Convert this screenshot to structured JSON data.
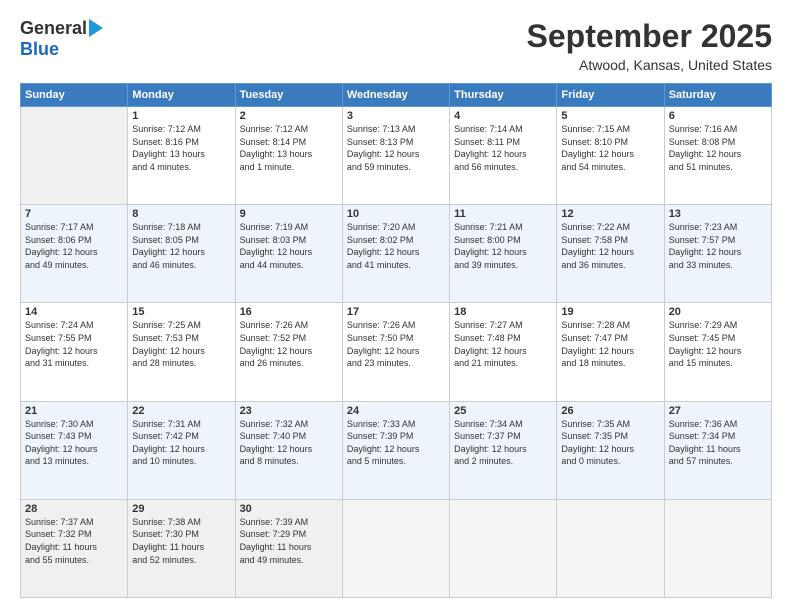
{
  "logo": {
    "general": "General",
    "blue": "Blue"
  },
  "title": "September 2025",
  "location": "Atwood, Kansas, United States",
  "days_of_week": [
    "Sunday",
    "Monday",
    "Tuesday",
    "Wednesday",
    "Thursday",
    "Friday",
    "Saturday"
  ],
  "weeks": [
    [
      {
        "day": "",
        "info": ""
      },
      {
        "day": "1",
        "info": "Sunrise: 7:12 AM\nSunset: 8:16 PM\nDaylight: 13 hours\nand 4 minutes."
      },
      {
        "day": "2",
        "info": "Sunrise: 7:12 AM\nSunset: 8:14 PM\nDaylight: 13 hours\nand 1 minute."
      },
      {
        "day": "3",
        "info": "Sunrise: 7:13 AM\nSunset: 8:13 PM\nDaylight: 12 hours\nand 59 minutes."
      },
      {
        "day": "4",
        "info": "Sunrise: 7:14 AM\nSunset: 8:11 PM\nDaylight: 12 hours\nand 56 minutes."
      },
      {
        "day": "5",
        "info": "Sunrise: 7:15 AM\nSunset: 8:10 PM\nDaylight: 12 hours\nand 54 minutes."
      },
      {
        "day": "6",
        "info": "Sunrise: 7:16 AM\nSunset: 8:08 PM\nDaylight: 12 hours\nand 51 minutes."
      }
    ],
    [
      {
        "day": "7",
        "info": "Sunrise: 7:17 AM\nSunset: 8:06 PM\nDaylight: 12 hours\nand 49 minutes."
      },
      {
        "day": "8",
        "info": "Sunrise: 7:18 AM\nSunset: 8:05 PM\nDaylight: 12 hours\nand 46 minutes."
      },
      {
        "day": "9",
        "info": "Sunrise: 7:19 AM\nSunset: 8:03 PM\nDaylight: 12 hours\nand 44 minutes."
      },
      {
        "day": "10",
        "info": "Sunrise: 7:20 AM\nSunset: 8:02 PM\nDaylight: 12 hours\nand 41 minutes."
      },
      {
        "day": "11",
        "info": "Sunrise: 7:21 AM\nSunset: 8:00 PM\nDaylight: 12 hours\nand 39 minutes."
      },
      {
        "day": "12",
        "info": "Sunrise: 7:22 AM\nSunset: 7:58 PM\nDaylight: 12 hours\nand 36 minutes."
      },
      {
        "day": "13",
        "info": "Sunrise: 7:23 AM\nSunset: 7:57 PM\nDaylight: 12 hours\nand 33 minutes."
      }
    ],
    [
      {
        "day": "14",
        "info": "Sunrise: 7:24 AM\nSunset: 7:55 PM\nDaylight: 12 hours\nand 31 minutes."
      },
      {
        "day": "15",
        "info": "Sunrise: 7:25 AM\nSunset: 7:53 PM\nDaylight: 12 hours\nand 28 minutes."
      },
      {
        "day": "16",
        "info": "Sunrise: 7:26 AM\nSunset: 7:52 PM\nDaylight: 12 hours\nand 26 minutes."
      },
      {
        "day": "17",
        "info": "Sunrise: 7:26 AM\nSunset: 7:50 PM\nDaylight: 12 hours\nand 23 minutes."
      },
      {
        "day": "18",
        "info": "Sunrise: 7:27 AM\nSunset: 7:48 PM\nDaylight: 12 hours\nand 21 minutes."
      },
      {
        "day": "19",
        "info": "Sunrise: 7:28 AM\nSunset: 7:47 PM\nDaylight: 12 hours\nand 18 minutes."
      },
      {
        "day": "20",
        "info": "Sunrise: 7:29 AM\nSunset: 7:45 PM\nDaylight: 12 hours\nand 15 minutes."
      }
    ],
    [
      {
        "day": "21",
        "info": "Sunrise: 7:30 AM\nSunset: 7:43 PM\nDaylight: 12 hours\nand 13 minutes."
      },
      {
        "day": "22",
        "info": "Sunrise: 7:31 AM\nSunset: 7:42 PM\nDaylight: 12 hours\nand 10 minutes."
      },
      {
        "day": "23",
        "info": "Sunrise: 7:32 AM\nSunset: 7:40 PM\nDaylight: 12 hours\nand 8 minutes."
      },
      {
        "day": "24",
        "info": "Sunrise: 7:33 AM\nSunset: 7:39 PM\nDaylight: 12 hours\nand 5 minutes."
      },
      {
        "day": "25",
        "info": "Sunrise: 7:34 AM\nSunset: 7:37 PM\nDaylight: 12 hours\nand 2 minutes."
      },
      {
        "day": "26",
        "info": "Sunrise: 7:35 AM\nSunset: 7:35 PM\nDaylight: 12 hours\nand 0 minutes."
      },
      {
        "day": "27",
        "info": "Sunrise: 7:36 AM\nSunset: 7:34 PM\nDaylight: 11 hours\nand 57 minutes."
      }
    ],
    [
      {
        "day": "28",
        "info": "Sunrise: 7:37 AM\nSunset: 7:32 PM\nDaylight: 11 hours\nand 55 minutes."
      },
      {
        "day": "29",
        "info": "Sunrise: 7:38 AM\nSunset: 7:30 PM\nDaylight: 11 hours\nand 52 minutes."
      },
      {
        "day": "30",
        "info": "Sunrise: 7:39 AM\nSunset: 7:29 PM\nDaylight: 11 hours\nand 49 minutes."
      },
      {
        "day": "",
        "info": ""
      },
      {
        "day": "",
        "info": ""
      },
      {
        "day": "",
        "info": ""
      },
      {
        "day": "",
        "info": ""
      }
    ]
  ]
}
